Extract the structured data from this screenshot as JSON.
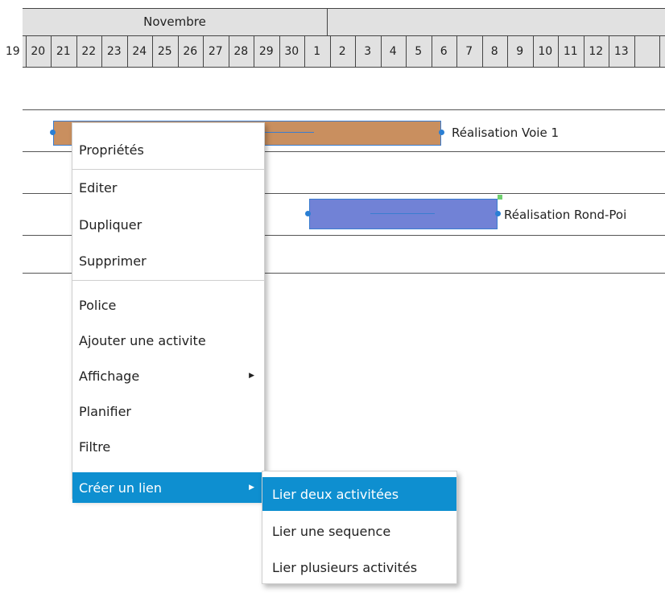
{
  "timeline": {
    "months": [
      {
        "label": "Novembre"
      },
      {
        "label": ""
      }
    ],
    "days": [
      "19",
      "20",
      "21",
      "22",
      "23",
      "24",
      "25",
      "26",
      "27",
      "28",
      "29",
      "30",
      "1",
      "2",
      "3",
      "4",
      "5",
      "6",
      "7",
      "8",
      "9",
      "10",
      "11",
      "12",
      "13",
      ""
    ]
  },
  "rows": {
    "activities": [
      {
        "label": "Réalisation Voie 1",
        "color": "#c98f5f"
      },
      {
        "label": "Réalisation Rond-Poi",
        "color": "#7182d6"
      }
    ]
  },
  "context_menu": {
    "items": [
      {
        "label": "Propriétés"
      },
      {
        "label": "Editer"
      },
      {
        "label": "Dupliquer"
      },
      {
        "label": "Supprimer"
      },
      {
        "label": "Police"
      },
      {
        "label": "Ajouter une activite"
      },
      {
        "label": "Affichage",
        "submenu": true
      },
      {
        "label": "Planifier"
      },
      {
        "label": "Filtre"
      },
      {
        "label": "Créer un lien",
        "submenu": true,
        "active": true
      }
    ]
  },
  "sub_menu": {
    "items": [
      {
        "label": "Lier deux activitées",
        "active": true
      },
      {
        "label": "Lier une sequence"
      },
      {
        "label": "Lier plusieurs activités"
      }
    ]
  },
  "colors": {
    "header_bg": "#e1e1e1",
    "grid_line": "#333333",
    "row_line": "#555555",
    "selection_blue": "#0e8fd0",
    "handle_blue": "#2a7fd4"
  }
}
